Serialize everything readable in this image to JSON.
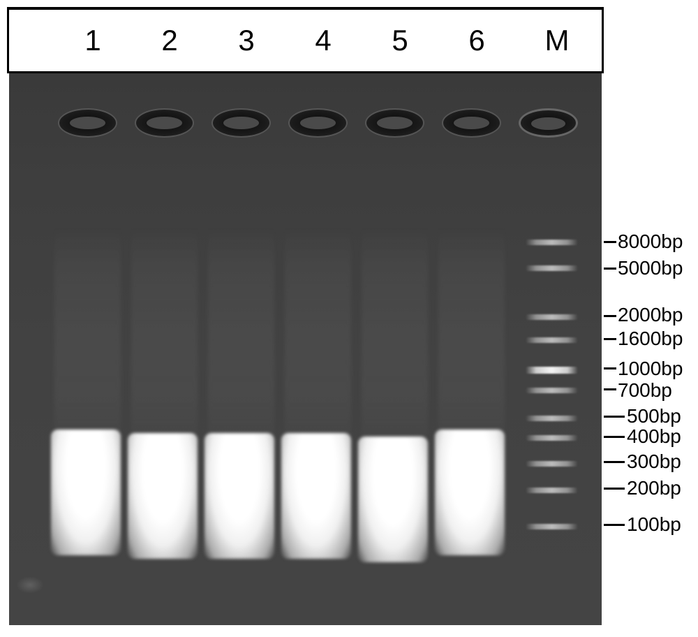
{
  "figure": {
    "description": "Agarose gel electrophoresis image",
    "lanes": {
      "lane1": "1",
      "lane2": "2",
      "lane3": "3",
      "lane4": "4",
      "lane5": "5",
      "lane6": "6",
      "marker": "M"
    },
    "ladder": {
      "band_8000": "8000bp",
      "band_5000": "5000bp",
      "band_2000": "2000bp",
      "band_1600": "1600bp",
      "band_1000": "1000bp",
      "band_700": "700bp",
      "band_500": "500bp",
      "band_400": "400bp",
      "band_300": "300bp",
      "band_200": "200bp",
      "band_100": "100bp"
    }
  }
}
